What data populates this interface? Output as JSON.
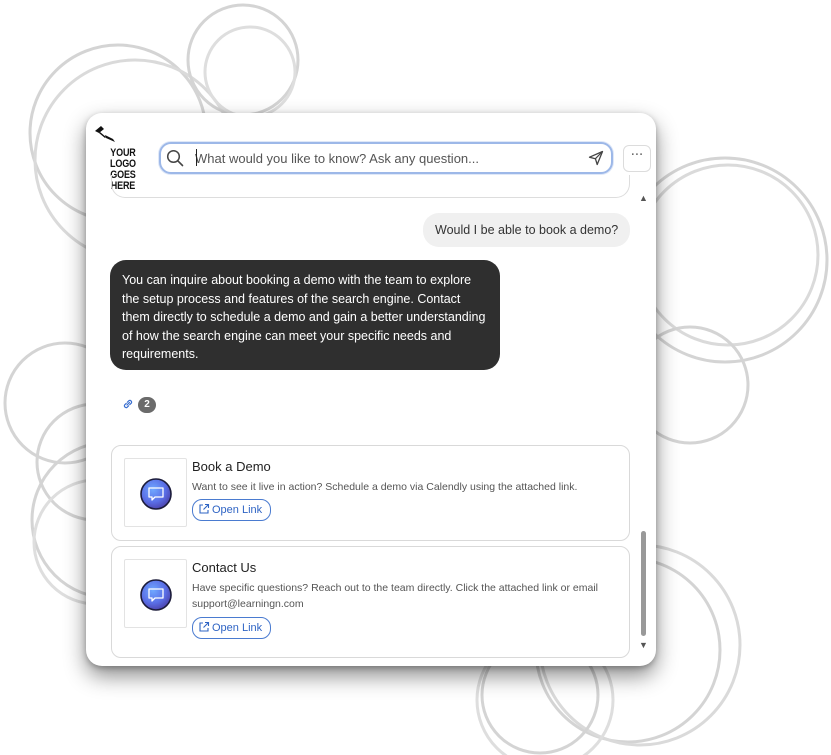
{
  "app": {
    "logo_line1": "YOUR LOGO",
    "logo_line2": "GOES HERE"
  },
  "search": {
    "placeholder": "What would you like to know? Ask any question...",
    "value": ""
  },
  "menu": {
    "more_label": "···"
  },
  "conversation": {
    "user_message": "Would I be able to book a demo?",
    "bot_message": "You can inquire about booking a demo with the team to explore the setup process and features of the search engine. Contact them directly to schedule a demo and gain a better understanding of how the search engine can meet your specific needs and requirements.",
    "sources_count": "2"
  },
  "cards": [
    {
      "title": "Book a Demo",
      "description": "Want to see it live in action? Schedule a demo via Calendly using the attached link.",
      "button_label": "Open Link"
    },
    {
      "title": "Contact Us",
      "description": "Have specific questions? Reach out to the team directly. Click the attached link or email support@learningn.com",
      "button_label": "Open Link"
    }
  ],
  "icons": {
    "search": "search-icon",
    "send": "send-icon",
    "link": "link-icon",
    "external": "external-link-icon",
    "chat": "chat-bubble-icon"
  },
  "colors": {
    "accent": "#2f64c4",
    "bot_bubble": "#2f2f2f",
    "user_bubble": "#f0f0f0",
    "search_border": "#9db8e8"
  }
}
